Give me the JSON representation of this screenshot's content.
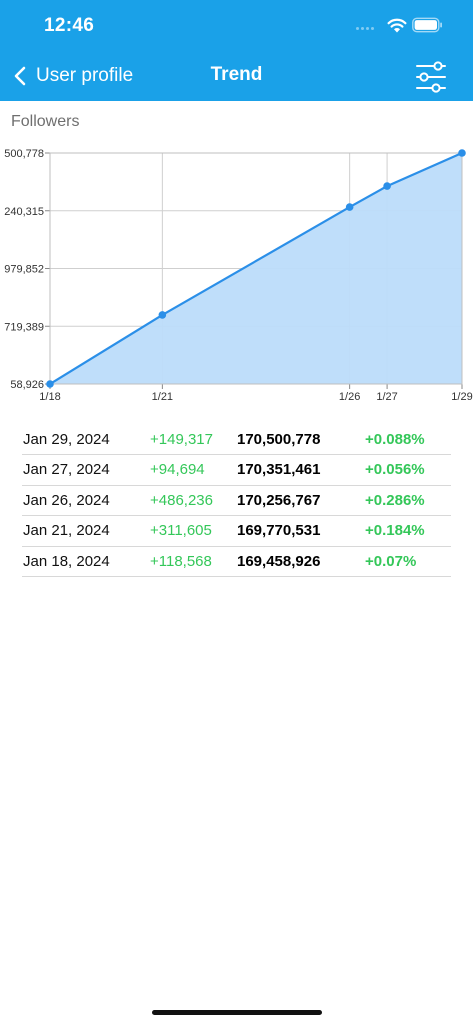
{
  "status_bar": {
    "time": "12:46"
  },
  "nav": {
    "back_label": "User profile",
    "title": "Trend"
  },
  "section_label": "Followers",
  "colors": {
    "accent": "#1aa1e8",
    "line": "#2b8fe8",
    "area": "#bcdcfa",
    "positive": "#34c759"
  },
  "chart_data": {
    "type": "area",
    "x": [
      "1/18",
      "1/21",
      "1/26",
      "1/27",
      "1/29"
    ],
    "x_days": [
      18,
      21,
      26,
      27,
      29
    ],
    "values": [
      169458926,
      169770531,
      170256767,
      170351461,
      170500778
    ],
    "y_ticks": [
      169458926,
      169719389,
      169979852,
      170240315,
      170500778
    ],
    "y_tick_labels": [
      "58,926",
      "719,389",
      "979,852",
      "240,315",
      "500,778"
    ],
    "x_tick_labels": [
      "1/18",
      "1/21",
      "1/26",
      "1/27",
      "1/29"
    ],
    "ylim": [
      169458926,
      170500778
    ],
    "grid": true
  },
  "table": {
    "rows": [
      {
        "date": "Jan 29, 2024",
        "change": "+149,317",
        "total": "170,500,778",
        "pct": "+0.088%"
      },
      {
        "date": "Jan 27, 2024",
        "change": "+94,694",
        "total": "170,351,461",
        "pct": "+0.056%"
      },
      {
        "date": "Jan 26, 2024",
        "change": "+486,236",
        "total": "170,256,767",
        "pct": "+0.286%"
      },
      {
        "date": "Jan 21, 2024",
        "change": "+311,605",
        "total": "169,770,531",
        "pct": "+0.184%"
      },
      {
        "date": "Jan 18, 2024",
        "change": "+118,568",
        "total": "169,458,926",
        "pct": "+0.07%"
      }
    ]
  }
}
